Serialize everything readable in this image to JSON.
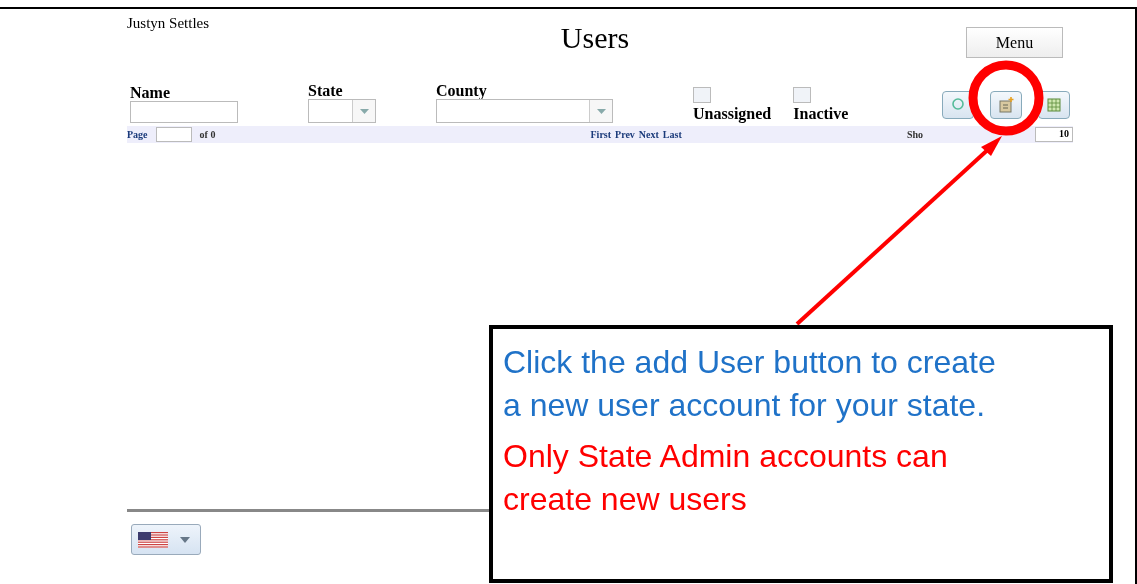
{
  "user": "Justyn Settles",
  "title": "Users",
  "menu_button": "Menu",
  "filters": [
    {
      "kind": "text",
      "label": "Name"
    },
    {
      "kind": "select",
      "label": "State"
    },
    {
      "kind": "select",
      "label": "County"
    }
  ],
  "checkboxes": [
    {
      "label": "Unassigned",
      "checked": false
    },
    {
      "label": "Inactive",
      "checked": false
    }
  ],
  "pager": {
    "page_label": "Page",
    "of_label": "of 0",
    "nav": [
      "First",
      "Prev",
      "Next",
      "Last"
    ],
    "show_label": "Sho",
    "page_size": "10"
  },
  "callout": {
    "instruction": "Click the add User button to create a new user account for your state.",
    "note": "Only State Admin accounts can create new users"
  }
}
